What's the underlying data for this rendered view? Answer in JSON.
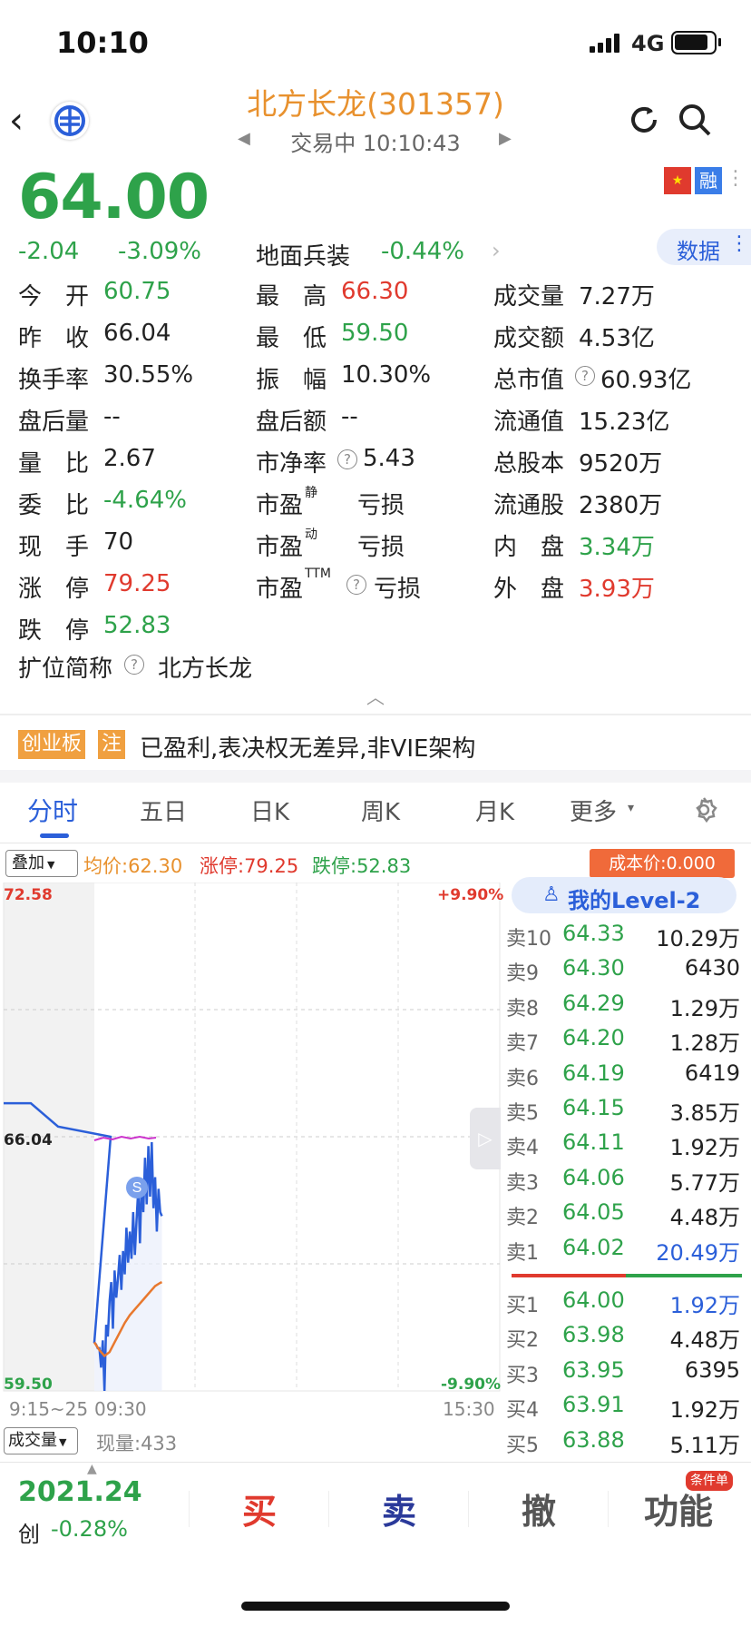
{
  "status_bar": {
    "time": "10:10",
    "network": "4G"
  },
  "header": {
    "title": "北方长龙(301357)",
    "trade_status": "交易中 10:10:43"
  },
  "badges": {
    "cn_flag": "CN",
    "rong": "融",
    "data_label": "数据"
  },
  "price": {
    "current": "64.00",
    "change": "-2.04",
    "change_pct": "-3.09%",
    "sector_name": "地面兵装",
    "sector_change": "-0.44%"
  },
  "quote_rows": [
    [
      {
        "l": "今　开",
        "v": "60.75",
        "c": "green"
      },
      {
        "l": "最　高",
        "v": "66.30",
        "c": "red"
      },
      {
        "l": "成交量",
        "v": "7.27万",
        "c": "black"
      }
    ],
    [
      {
        "l": "昨　收",
        "v": "66.04",
        "c": "black"
      },
      {
        "l": "最　低",
        "v": "59.50",
        "c": "green"
      },
      {
        "l": "成交额",
        "v": "4.53亿",
        "c": "black"
      }
    ],
    [
      {
        "l": "换手率",
        "v": "30.55%",
        "c": "black"
      },
      {
        "l": "振　幅",
        "v": "10.30%",
        "c": "black"
      },
      {
        "l": "总市值",
        "v": "60.93亿",
        "c": "black",
        "q": true
      }
    ],
    [
      {
        "l": "盘后量",
        "v": "--",
        "c": "black"
      },
      {
        "l": "盘后额",
        "v": "--",
        "c": "black"
      },
      {
        "l": "流通值",
        "v": "15.23亿",
        "c": "black"
      }
    ],
    [
      {
        "l": "量　比",
        "v": "2.67",
        "c": "black"
      },
      {
        "l": "市净率",
        "v": "5.43",
        "c": "black",
        "q": true
      },
      {
        "l": "总股本",
        "v": "9520万",
        "c": "black"
      }
    ],
    [
      {
        "l": "委　比",
        "v": "-4.64%",
        "c": "green"
      },
      {
        "l": "市盈",
        "sup": "静",
        "v": "亏损",
        "c": "black"
      },
      {
        "l": "流通股",
        "v": "2380万",
        "c": "black"
      }
    ],
    [
      {
        "l": "现　手",
        "v": "70",
        "c": "black"
      },
      {
        "l": "市盈",
        "sup": "动",
        "v": "亏损",
        "c": "black"
      },
      {
        "l": "内　盘",
        "v": "3.34万",
        "c": "green"
      }
    ],
    [
      {
        "l": "涨　停",
        "v": "79.25",
        "c": "red"
      },
      {
        "l": "市盈",
        "sup": "TTM",
        "v": "亏损",
        "c": "black",
        "q": true
      },
      {
        "l": "外　盘",
        "v": "3.93万",
        "c": "red"
      }
    ],
    [
      {
        "l": "跌　停",
        "v": "52.83",
        "c": "green"
      }
    ]
  ],
  "short_name": {
    "label": "扩位简称",
    "value": "北方长龙"
  },
  "board": {
    "tag": "创业板",
    "note_tag": "注",
    "desc": "已盈利,表决权无差异,非VIE架构"
  },
  "tabs": [
    "分时",
    "五日",
    "日K",
    "周K",
    "月K",
    "更多"
  ],
  "chart_bar": {
    "overlay": "叠加",
    "avg": "均价:62.30",
    "up_limit": "涨停:79.25",
    "down_limit": "跌停:52.83",
    "cost": "成本价:0.000"
  },
  "chart_labels": {
    "y_top": "72.58",
    "y_mid": "66.04",
    "y_bottom": "59.50",
    "pct_top": "+9.90%",
    "pct_bottom": "-9.90%",
    "x_start": "9:15~25",
    "x_open": "09:30",
    "x_end": "15:30",
    "volume_selector": "成交量",
    "current_vol": "现量:433"
  },
  "chart_data": {
    "type": "line",
    "ylim": [
      59.5,
      72.58
    ],
    "series": [
      {
        "name": "价格",
        "x": [
          "09:15",
          "09:20",
          "09:25",
          "09:25",
          "09:30",
          "09:31",
          "09:32",
          "09:33",
          "09:34",
          "09:35",
          "09:36",
          "09:37",
          "09:38",
          "09:39",
          "09:40",
          "09:41",
          "09:42",
          "09:43",
          "09:44",
          "09:45",
          "09:46",
          "09:47",
          "09:48",
          "09:49",
          "09:50",
          "09:51",
          "09:52",
          "09:53",
          "09:54",
          "09:55",
          "09:56",
          "09:57",
          "09:58",
          "09:59",
          "10:00",
          "10:01",
          "10:02",
          "10:03",
          "10:04",
          "10:05",
          "10:06",
          "10:07",
          "10:08",
          "10:09",
          "10:10"
        ],
        "values": [
          66.9,
          66.9,
          66.3,
          66.04,
          60.75,
          60.7,
          60.6,
          60.6,
          60.1,
          60.8,
          59.5,
          61.2,
          60.9,
          61.8,
          62.3,
          61.1,
          62.6,
          61.9,
          62.4,
          63.0,
          62.1,
          63.1,
          62.5,
          63.7,
          62.8,
          63.6,
          62.9,
          64.1,
          63.0,
          63.9,
          64.7,
          63.3,
          64.9,
          64.1,
          65.5,
          64.3,
          65.8,
          64.5,
          65.9,
          64.2,
          65.0,
          63.6,
          64.7,
          64.1,
          64.0
        ]
      },
      {
        "name": "均价",
        "x": [
          "09:30",
          "09:33",
          "09:36",
          "09:39",
          "09:42",
          "09:45",
          "09:48",
          "09:51",
          "09:54",
          "09:57",
          "10:00",
          "10:03",
          "10:06",
          "10:09",
          "10:10"
        ],
        "values": [
          60.75,
          60.55,
          60.4,
          60.5,
          60.75,
          61.0,
          61.25,
          61.45,
          61.6,
          61.75,
          61.9,
          62.05,
          62.2,
          62.28,
          62.3
        ]
      }
    ]
  },
  "order_book": {
    "title": "我的Level-2",
    "asks": [
      {
        "n": "卖10",
        "p": "64.33",
        "v": "10.29万"
      },
      {
        "n": "卖9",
        "p": "64.30",
        "v": "6430"
      },
      {
        "n": "卖8",
        "p": "64.29",
        "v": "1.29万"
      },
      {
        "n": "卖7",
        "p": "64.20",
        "v": "1.28万"
      },
      {
        "n": "卖6",
        "p": "64.19",
        "v": "6419"
      },
      {
        "n": "卖5",
        "p": "64.15",
        "v": "3.85万"
      },
      {
        "n": "卖4",
        "p": "64.11",
        "v": "1.92万"
      },
      {
        "n": "卖3",
        "p": "64.06",
        "v": "5.77万"
      },
      {
        "n": "卖2",
        "p": "64.05",
        "v": "4.48万"
      },
      {
        "n": "卖1",
        "p": "64.02",
        "v": "20.49万",
        "vc": "blue"
      }
    ],
    "bids": [
      {
        "n": "买1",
        "p": "64.00",
        "v": "1.92万",
        "vc": "blue"
      },
      {
        "n": "买2",
        "p": "63.98",
        "v": "4.48万"
      },
      {
        "n": "买3",
        "p": "63.95",
        "v": "6395"
      },
      {
        "n": "买4",
        "p": "63.91",
        "v": "1.92万"
      },
      {
        "n": "买5",
        "p": "63.88",
        "v": "5.11万"
      }
    ]
  },
  "bottom": {
    "index_value": "2021.24",
    "index_name": "创",
    "index_change": "-0.28%",
    "buy": "买",
    "sell": "卖",
    "cancel": "撤",
    "function": "功能",
    "cond_badge": "条件单"
  },
  "colors": {
    "up": "#e03a2e",
    "down": "#2ea24a",
    "accent": "#e8912e",
    "line": "#2b5fd9",
    "avg": "#e8782e"
  }
}
